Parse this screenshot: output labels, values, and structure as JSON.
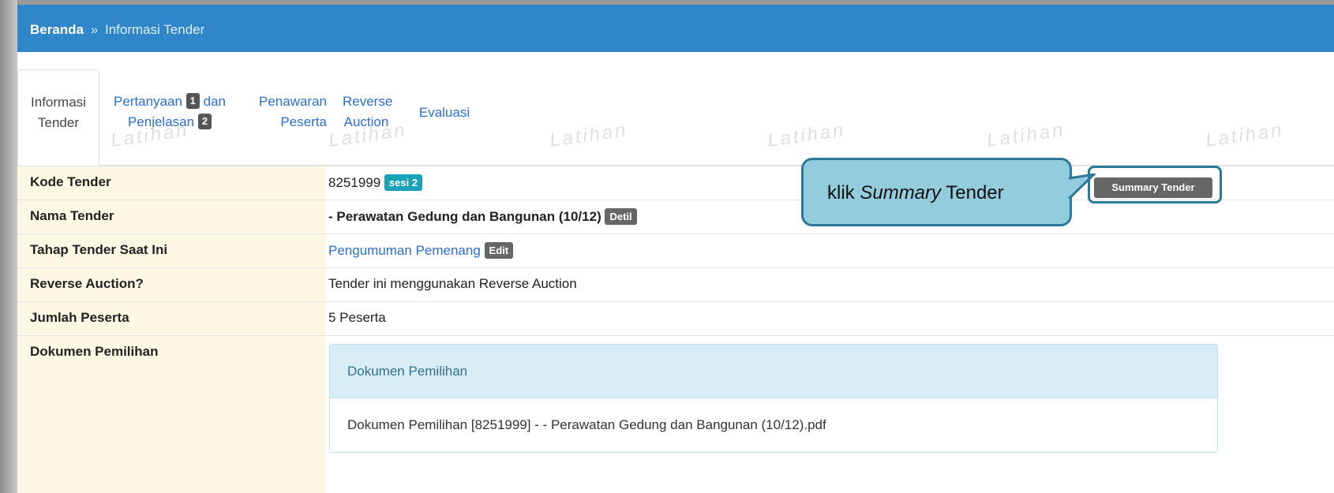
{
  "breadcrumb": {
    "home": "Beranda",
    "separator": "»",
    "current": "Informasi Tender"
  },
  "tabs": [
    {
      "line1": "Informasi",
      "line2": "Tender",
      "active": true
    },
    {
      "line1a": "Pertanyaan",
      "badge1": "1",
      "line1b": "dan",
      "line2a": "Penjelasan",
      "badge2": "2"
    },
    {
      "line1": "Penawaran",
      "line2": "Peserta"
    },
    {
      "line1": "Reverse",
      "line2": "Auction"
    },
    {
      "line1": "Evaluasi"
    }
  ],
  "watermark": "Latihan",
  "rows": {
    "kode": {
      "label": "Kode Tender",
      "value": "8251999",
      "badge": "sesi 2"
    },
    "nama": {
      "label": "Nama Tender",
      "value": "- Perawatan Gedung dan Bangunan (10/12)",
      "badge": "Detil"
    },
    "tahap": {
      "label": "Tahap Tender Saat Ini",
      "value": "Pengumuman Pemenang",
      "badge": "Edit"
    },
    "reverse": {
      "label": "Reverse Auction?",
      "value": "Tender ini menggunakan Reverse Auction"
    },
    "jumlah": {
      "label": "Jumlah Peserta",
      "value": "5 Peserta"
    },
    "dokumen": {
      "label": "Dokumen Pemilihan",
      "panel_heading": "Dokumen Pemilihan",
      "file": "Dokumen Pemilihan [8251999] - - Perawatan Gedung dan Bangunan (10/12).pdf"
    }
  },
  "summary_button": "Summary Tender",
  "callout": {
    "prefix": "klik ",
    "italic": "Summary",
    "suffix": " Tender"
  },
  "colors": {
    "header_blue": "#2f86c9",
    "label_bg": "#fcf8e3",
    "callout_fill": "#93cddd",
    "callout_border": "#2b7a99"
  }
}
